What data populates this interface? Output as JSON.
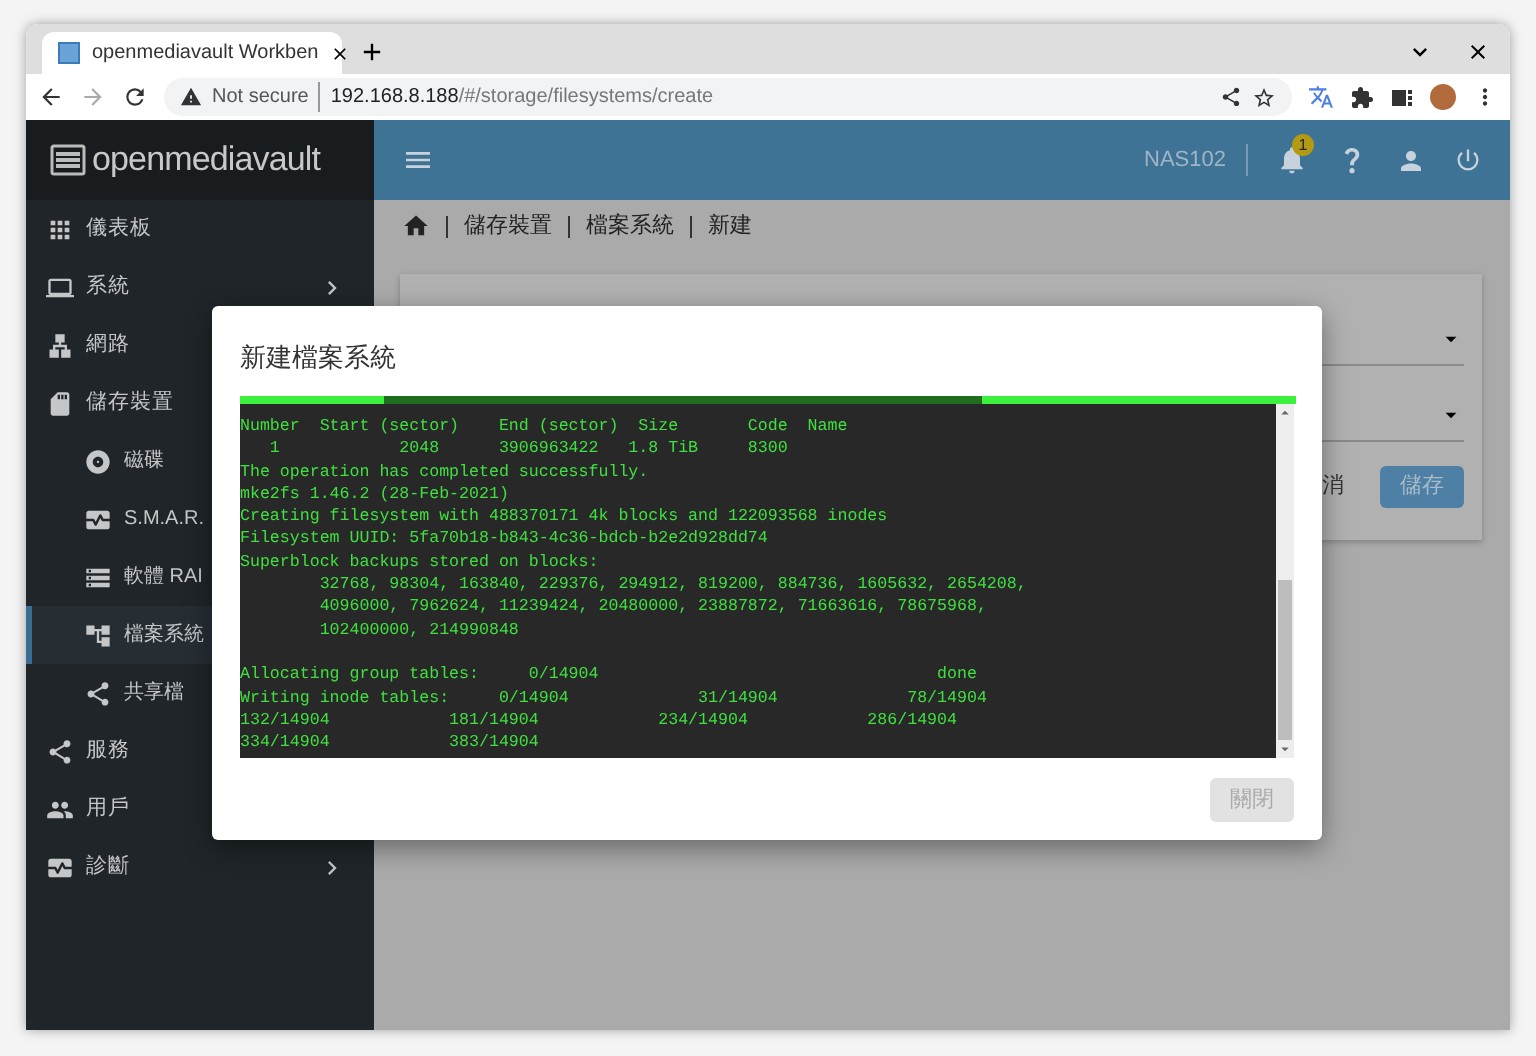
{
  "browser": {
    "tab_title": "openmediavault Workben",
    "security_label": "Not secure",
    "url": {
      "host": "192.168.8.188",
      "path": "/#/storage/filesystems/create"
    }
  },
  "app": {
    "logo": "openmediavault",
    "hostname": "NAS102",
    "notification_count": "1"
  },
  "sidebar": {
    "items": [
      {
        "label": "儀表板",
        "selected": false,
        "has_submenu": false
      },
      {
        "label": "系統",
        "selected": false,
        "has_submenu": true
      },
      {
        "label": "網路",
        "selected": false,
        "has_submenu": false
      },
      {
        "label": "儲存裝置",
        "selected": false,
        "has_submenu": false,
        "children": [
          {
            "label": "磁碟",
            "selected": false
          },
          {
            "label": "S.M.A.R.",
            "selected": false
          },
          {
            "label": "軟體 RAI",
            "selected": false
          },
          {
            "label": "檔案系統",
            "selected": true
          },
          {
            "label": "共享檔",
            "selected": false
          }
        ]
      },
      {
        "label": "服務",
        "selected": false,
        "has_submenu": false
      },
      {
        "label": "用戶",
        "selected": false,
        "has_submenu": false
      },
      {
        "label": "診斷",
        "selected": false,
        "has_submenu": true
      }
    ]
  },
  "breadcrumb": [
    "儲存裝置",
    "檔案系統",
    "新建"
  ],
  "form": {
    "buttons": [
      {
        "label": "消",
        "kind": "text"
      },
      {
        "label": "儲存",
        "kind": "primary"
      }
    ]
  },
  "dialog": {
    "title": "新建檔案系統",
    "output_blocks": [
      [
        "Number  Start (sector)    End (sector)  Size       Code  Name",
        "   1            2048      3906963422   1.8 TiB     8300",
        "The operation has completed successfully.",
        "mke2fs 1.46.2 (28-Feb-2021)",
        "Creating filesystem with 488370171 4k blocks and 122093568 inodes",
        "Filesystem UUID: 5fa70b18-b843-4c36-bdcb-b2e2d928dd74",
        "Superblock backups stored on blocks:",
        "        32768, 98304, 163840, 229376, 294912, 819200, 884736, 1605632, 2654208,",
        "        4096000, 7962624, 11239424, 20480000, 23887872, 71663616, 78675968,",
        "        102400000, 214990848"
      ],
      [
        "Allocating group tables:     0/14904                                  done",
        "Writing inode tables:     0/14904             31/14904             78/14904",
        "132/14904            181/14904            234/14904            286/14904",
        "334/14904            383/14904"
      ]
    ],
    "close_button": {
      "label": "關閉",
      "disabled": true
    }
  }
}
